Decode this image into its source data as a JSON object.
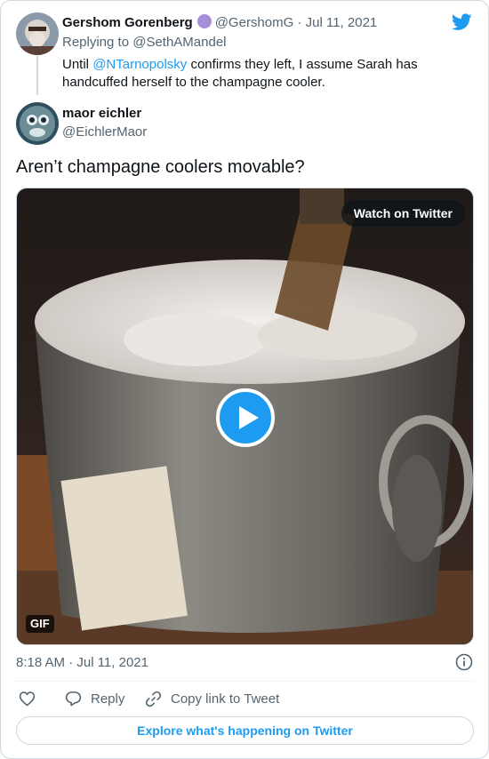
{
  "parent_tweet": {
    "display_name": "Gershom Gorenberg",
    "handle": "@GershomG",
    "separator": "·",
    "date": "Jul 11, 2021",
    "replying_to": "Replying to @SethAMandel",
    "text_before": "Until ",
    "mention": "@NTarnopolsky",
    "text_after": " confirms they left, I assume Sarah has handcuffed herself to the champagne cooler.",
    "badge_color": "#a58fd6"
  },
  "tweet": {
    "display_name": "maor eichler",
    "handle": "@EichlerMaor",
    "text": "Aren’t champagne coolers movable?",
    "timestamp": "8:18 AM · Jul 11, 2021"
  },
  "media": {
    "watch_label": "Watch on Twitter",
    "badge": "GIF"
  },
  "actions": {
    "reply_label": "Reply",
    "copy_label": "Copy link to Tweet"
  },
  "footer": {
    "explore_label": "Explore what's happening on Twitter"
  },
  "icons": [
    "twitter-bird-icon",
    "heart-icon",
    "reply-icon",
    "link-icon",
    "info-icon",
    "play-icon"
  ],
  "colors": {
    "accent": "#1d9bf0",
    "muted_text": "#536471",
    "border": "#cfd9de"
  }
}
